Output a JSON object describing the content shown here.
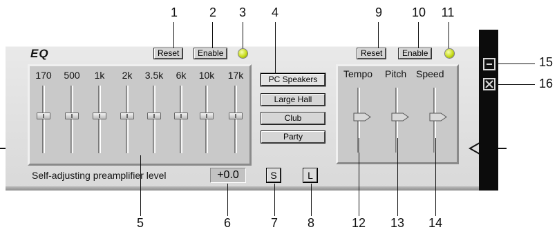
{
  "window": {
    "title": "EQ"
  },
  "eq": {
    "reset_label": "Reset",
    "enable_label": "Enable",
    "bands": [
      {
        "label": "170",
        "level": 0.55
      },
      {
        "label": "500",
        "level": 0.55
      },
      {
        "label": "1k",
        "level": 0.55
      },
      {
        "label": "2k",
        "level": 0.55
      },
      {
        "label": "3.5k",
        "level": 0.55
      },
      {
        "label": "6k",
        "level": 0.55
      },
      {
        "label": "10k",
        "level": 0.55
      },
      {
        "label": "17k",
        "level": 0.55
      }
    ],
    "preamp_label": "Self-adjusting preamplifier level",
    "preamp_value": "+0.0",
    "save_label": "S",
    "load_label": "L"
  },
  "presets": [
    {
      "label": "PC Speakers",
      "active": true
    },
    {
      "label": "Large Hall",
      "active": false
    },
    {
      "label": "Club",
      "active": false
    },
    {
      "label": "Party",
      "active": false
    }
  ],
  "speed": {
    "reset_label": "Reset",
    "enable_label": "Enable",
    "sliders": [
      {
        "label": "Tempo",
        "level": 0.55
      },
      {
        "label": "Pitch",
        "level": 0.55
      },
      {
        "label": "Speed",
        "level": 0.55
      }
    ]
  },
  "callouts": {
    "c1": "1",
    "c2": "2",
    "c3": "3",
    "c4": "4",
    "c5": "5",
    "c6": "6",
    "c7": "7",
    "c8": "8",
    "c9": "9",
    "c10": "10",
    "c11": "11",
    "c12": "12",
    "c13": "13",
    "c14": "14",
    "c15": "15",
    "c16": "16"
  },
  "colors": {
    "led": "#c8dc1a",
    "panel": "#d9d9d9",
    "bar": "#0c0c0c"
  },
  "icons": {
    "minimize": "minimize-icon",
    "close": "close-icon",
    "led": "led-indicator-icon"
  }
}
